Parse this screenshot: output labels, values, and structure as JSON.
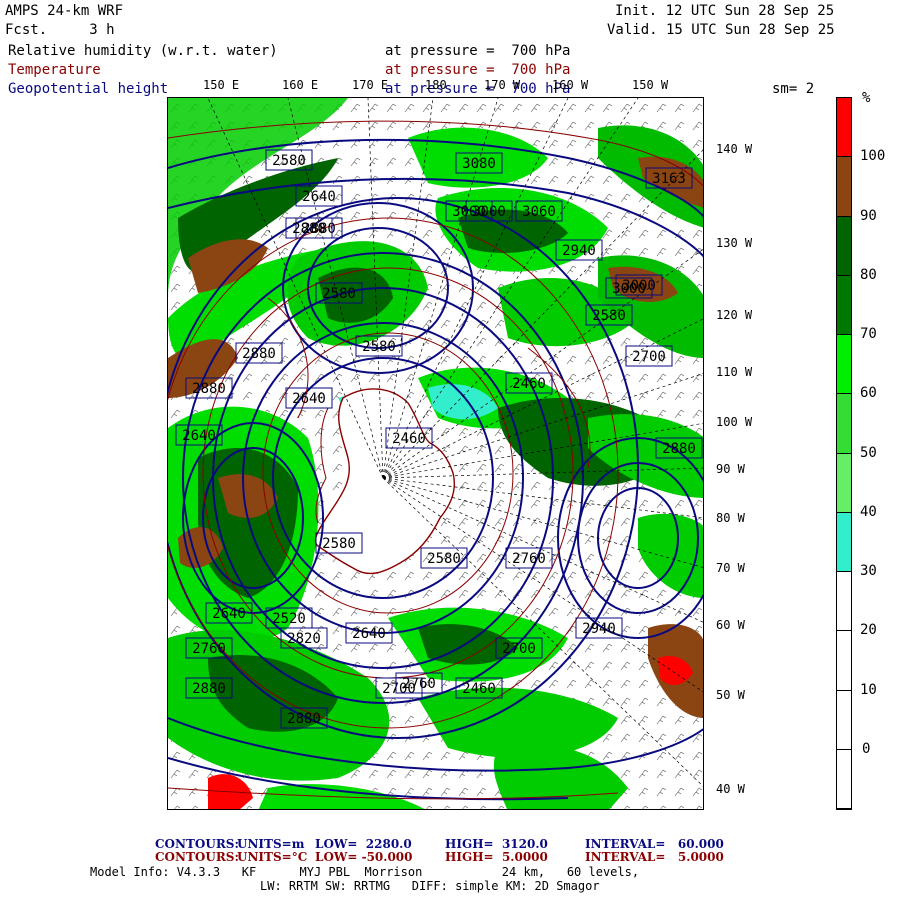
{
  "header": {
    "model": "AMPS 24-km WRF",
    "forecast": "Fcst.     3 h",
    "init": "Init. 12 UTC Sun 28 Sep 25",
    "valid": "Valid. 15 UTC Sun 28 Sep 25"
  },
  "fields": [
    {
      "name": "Relative humidity (w.r.t. water)",
      "level": "at pressure =  700 hPa",
      "color": "#000000"
    },
    {
      "name": "Temperature",
      "level": "at pressure =  700 hPa",
      "color": "#8b0000"
    },
    {
      "name": "Geopotential height",
      "level": "at pressure =  700 hPa",
      "color": "#0a0a80"
    }
  ],
  "smoothing": "sm= 2",
  "lon_labels_top": [
    "150 E",
    "160 E",
    "170 E",
    "180",
    "170 W",
    "160 W",
    "150 W"
  ],
  "lon_labels_right": [
    "140 W",
    "130 W",
    "120 W",
    "110 W",
    "100 W",
    "90 W",
    "80 W",
    "70 W",
    "60 W",
    "50 W",
    "40 W"
  ],
  "colorbar": {
    "unit": "%",
    "labels": [
      "100",
      "90",
      "80",
      "70",
      "60",
      "50",
      "40",
      "30",
      "20",
      "10",
      "0"
    ],
    "segments": [
      {
        "from": 100,
        "to": 110,
        "color": "#ff0000"
      },
      {
        "from": 90,
        "to": 100,
        "color": "#8b4513"
      },
      {
        "from": 80,
        "to": 90,
        "color": "#006400"
      },
      {
        "from": 70,
        "to": 80,
        "color": "#007800"
      },
      {
        "from": 60,
        "to": 70,
        "color": "#00ee00"
      },
      {
        "from": 50,
        "to": 60,
        "color": "#33dd33"
      },
      {
        "from": 40,
        "to": 50,
        "color": "#66ee66"
      },
      {
        "from": 30,
        "to": 40,
        "color": "#33eecc"
      },
      {
        "from": 20,
        "to": 30,
        "color": "#ffffff"
      },
      {
        "from": 10,
        "to": 20,
        "color": "#ffffff"
      },
      {
        "from": 0,
        "to": 10,
        "color": "#ffffff"
      },
      {
        "from": -10,
        "to": 0,
        "color": "#ffffff"
      }
    ]
  },
  "height_labels": [
    "2580",
    "2640",
    "2880",
    "3000",
    "3080",
    "3000",
    "3060",
    "3163",
    "3000",
    "2880",
    "2940",
    "3000",
    "2580",
    "2580",
    "2880",
    "2460",
    "2880",
    "2640",
    "2580",
    "2700",
    "2460",
    "2640",
    "2580",
    "2520",
    "2640",
    "2820",
    "2760",
    "2880",
    "2880",
    "2460",
    "2640",
    "2580",
    "2700",
    "2760",
    "2700",
    "2940",
    "2760",
    "2880"
  ],
  "footer": {
    "line1": {
      "label": "CONTOURS:",
      "units": "UNITS=m",
      "low": "LOW=  2280.0",
      "high": "HIGH=  3120.0",
      "interval": "INTERVAL=   60.000"
    },
    "line2": {
      "label": "CONTOURS:",
      "units": "UNITS=°C",
      "low": "LOW= -50.000",
      "high": "HIGH=  5.0000",
      "interval": "INTERVAL=   5.0000"
    },
    "model_info": "Model Info: V4.3.3   KF      MYJ PBL  Morrison           24 km,   60 levels,",
    "physics": "LW: RRTM SW: RRTMG   DIFF: simple KM: 2D Smagor"
  }
}
